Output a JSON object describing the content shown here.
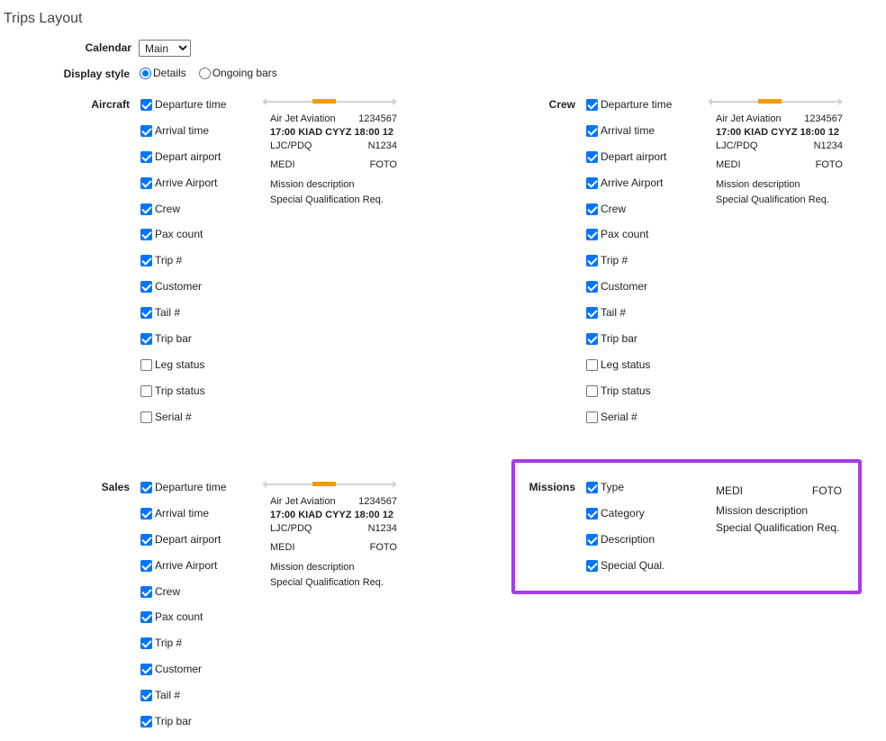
{
  "page": {
    "title": "Trips Layout"
  },
  "calendar": {
    "label": "Calendar",
    "value": "Main"
  },
  "display_style": {
    "label": "Display style",
    "options": [
      {
        "label": "Details",
        "selected": true
      },
      {
        "label": "Ongoing bars",
        "selected": false
      }
    ]
  },
  "preview": {
    "company": "Air Jet Aviation",
    "trip_no": "1234567",
    "times": "17:00 KIAD CYYZ 18:00 12",
    "crew": "LJC/PDQ",
    "tail": "N1234",
    "type": "MEDI",
    "category": "FOTO",
    "description": "Mission description",
    "qualification": "Special Qualification Req."
  },
  "aircraft": {
    "label": "Aircraft",
    "items": [
      {
        "label": "Departure time",
        "checked": true
      },
      {
        "label": "Arrival time",
        "checked": true
      },
      {
        "label": "Depart airport",
        "checked": true
      },
      {
        "label": "Arrive Airport",
        "checked": true
      },
      {
        "label": "Crew",
        "checked": true
      },
      {
        "label": "Pax count",
        "checked": true
      },
      {
        "label": "Trip #",
        "checked": true
      },
      {
        "label": "Customer",
        "checked": true
      },
      {
        "label": "Tail #",
        "checked": true
      },
      {
        "label": "Trip bar",
        "checked": true
      },
      {
        "label": "Leg status",
        "checked": false
      },
      {
        "label": "Trip status",
        "checked": false
      },
      {
        "label": "Serial #",
        "checked": false
      }
    ]
  },
  "crew": {
    "label": "Crew",
    "items": [
      {
        "label": "Departure time",
        "checked": true
      },
      {
        "label": "Arrival time",
        "checked": true
      },
      {
        "label": "Depart airport",
        "checked": true
      },
      {
        "label": "Arrive Airport",
        "checked": true
      },
      {
        "label": "Crew",
        "checked": true
      },
      {
        "label": "Pax count",
        "checked": true
      },
      {
        "label": "Trip #",
        "checked": true
      },
      {
        "label": "Customer",
        "checked": true
      },
      {
        "label": "Tail #",
        "checked": true
      },
      {
        "label": "Trip bar",
        "checked": true
      },
      {
        "label": "Leg status",
        "checked": false
      },
      {
        "label": "Trip status",
        "checked": false
      },
      {
        "label": "Serial #",
        "checked": false
      }
    ]
  },
  "sales": {
    "label": "Sales",
    "items": [
      {
        "label": "Departure time",
        "checked": true
      },
      {
        "label": "Arrival time",
        "checked": true
      },
      {
        "label": "Depart airport",
        "checked": true
      },
      {
        "label": "Arrive Airport",
        "checked": true
      },
      {
        "label": "Crew",
        "checked": true
      },
      {
        "label": "Pax count",
        "checked": true
      },
      {
        "label": "Trip #",
        "checked": true
      },
      {
        "label": "Customer",
        "checked": true
      },
      {
        "label": "Tail #",
        "checked": true
      },
      {
        "label": "Trip bar",
        "checked": true
      }
    ]
  },
  "missions": {
    "label": "Missions",
    "items": [
      {
        "label": "Type",
        "checked": true
      },
      {
        "label": "Category",
        "checked": true
      },
      {
        "label": "Description",
        "checked": true
      },
      {
        "label": "Special Qual.",
        "checked": true
      }
    ]
  },
  "colors": {
    "accent": "#0075ff",
    "trip_bar": "#f59a00",
    "highlight": "#a93be8"
  }
}
